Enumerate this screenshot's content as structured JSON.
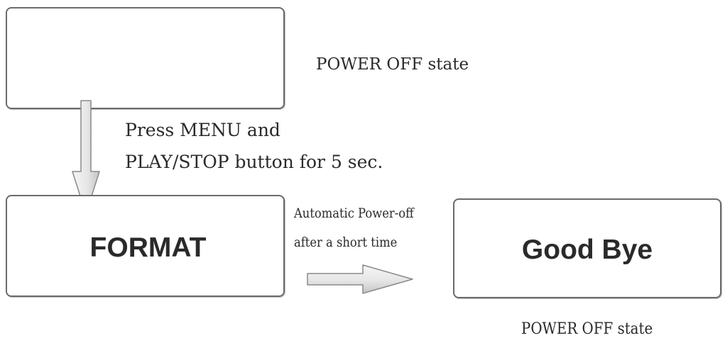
{
  "states": {
    "top_box_text": "",
    "format_box_text": "FORMAT",
    "goodbye_box_text": "Good Bye"
  },
  "captions": {
    "power_off_top": "POWER OFF state",
    "press_line_1": "Press MENU and",
    "press_line_2": "PLAY/STOP button for 5 sec.",
    "auto_line_1": "Automatic Power-off",
    "auto_line_2": "after a short time",
    "power_off_bottom": "POWER OFF state"
  },
  "colors": {
    "box_border": "#6b6b6b",
    "text": "#2a2a2a",
    "arrow_fill_light": "#f6f6f6",
    "arrow_fill_dark": "#c4c4c4",
    "arrow_stroke": "#8a8a8a"
  }
}
